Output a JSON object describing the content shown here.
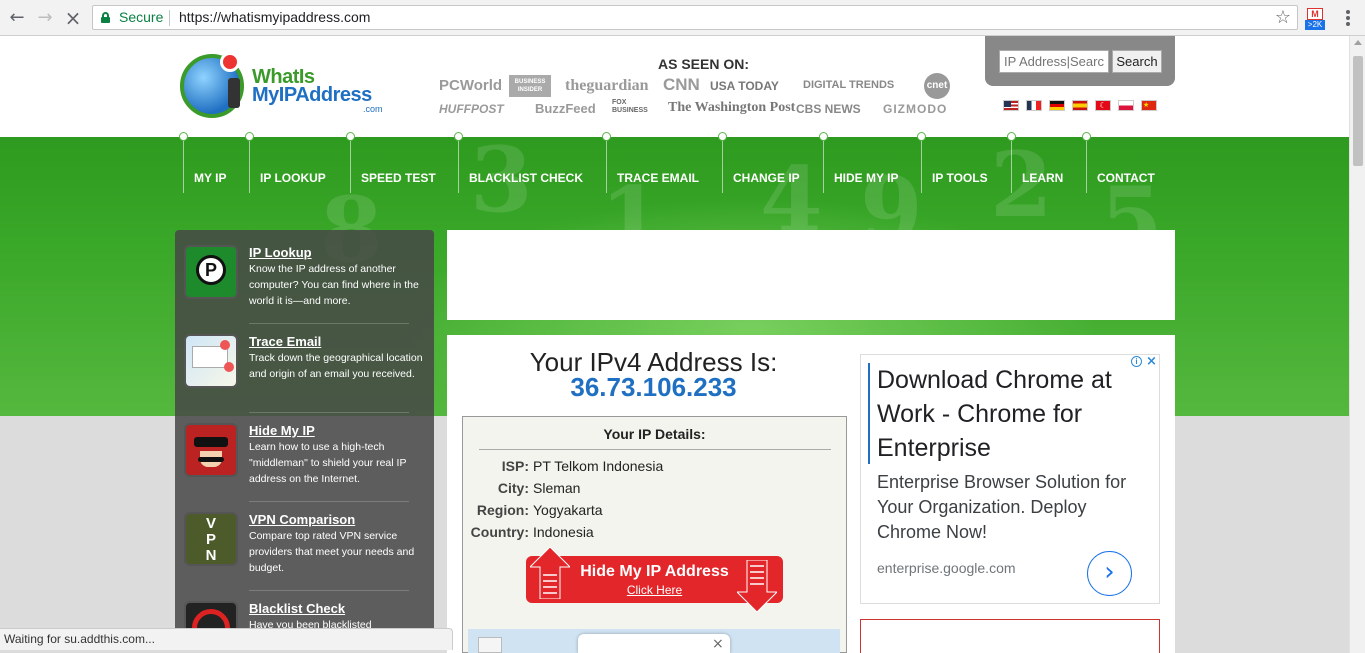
{
  "browser": {
    "secure_label": "Secure",
    "url": "https://whatismyipaddress.com",
    "ext_badge": ">2K",
    "status_text": "Waiting for su.addthis.com..."
  },
  "logo": {
    "line1": "WhatIs",
    "line2": "MyIPAddress",
    "suffix": ".com"
  },
  "seen_on": {
    "heading": "AS SEEN ON:",
    "outlets": [
      "PCWorld",
      "BUSINESS INSIDER",
      "theguardian",
      "CNN",
      "USA TODAY",
      "DIGITAL TRENDS",
      "cnet",
      "HUFFPOST",
      "BuzzFeed",
      "FOX BUSINESS",
      "The Washington Post",
      "CBS NEWS",
      "GIZMODO"
    ]
  },
  "search": {
    "placeholder": "IP Address|Search",
    "button": "Search"
  },
  "flags": [
    "us",
    "fr",
    "de",
    "es",
    "tr",
    "pl",
    "cn"
  ],
  "nav": [
    "MY IP",
    "IP LOOKUP",
    "SPEED TEST",
    "BLACKLIST CHECK",
    "TRACE EMAIL",
    "CHANGE IP",
    "HIDE MY IP",
    "IP TOOLS",
    "LEARN",
    "CONTACT"
  ],
  "sidebar": [
    {
      "title": "IP Lookup",
      "desc": "Know the IP address of another computer? You can find where in the world it is—and more.",
      "icon": "ip-lookup-icon"
    },
    {
      "title": "Trace Email",
      "desc": "Track down the geographical location and origin of an email you received.",
      "icon": "map-icon"
    },
    {
      "title": "Hide My IP",
      "desc": "Learn how to use a high-tech \"middleman\" to shield your real IP address on the Internet.",
      "icon": "spy-icon"
    },
    {
      "title": "VPN Comparison",
      "desc": "Compare top rated VPN service providers that meet your needs and budget.",
      "icon": "vpn-icon"
    },
    {
      "title": "Blacklist Check",
      "desc": "Have you been blacklisted",
      "icon": "blacklist-icon"
    }
  ],
  "main": {
    "heading": "Your IPv4 Address Is:",
    "ip": "36.73.106.233",
    "details_title": "Your IP Details:",
    "details": [
      {
        "key": "ISP:",
        "value": "PT Telkom Indonesia"
      },
      {
        "key": "City:",
        "value": "Sleman"
      },
      {
        "key": "Region:",
        "value": "Yogyakarta"
      },
      {
        "key": "Country:",
        "value": "Indonesia"
      }
    ],
    "hide_button": "Hide My IP Address",
    "hide_link": "Click Here"
  },
  "ad": {
    "headline": "Download Chrome at Work - Chrome for Enterprise",
    "body": "Enterprise Browser Solution for Your Organization. Deploy Chrome Now!",
    "url": "enterprise.google.com"
  },
  "colors": {
    "green": "#3aa829",
    "accent_blue": "#1f6fc2",
    "button_red": "#e3262a"
  }
}
